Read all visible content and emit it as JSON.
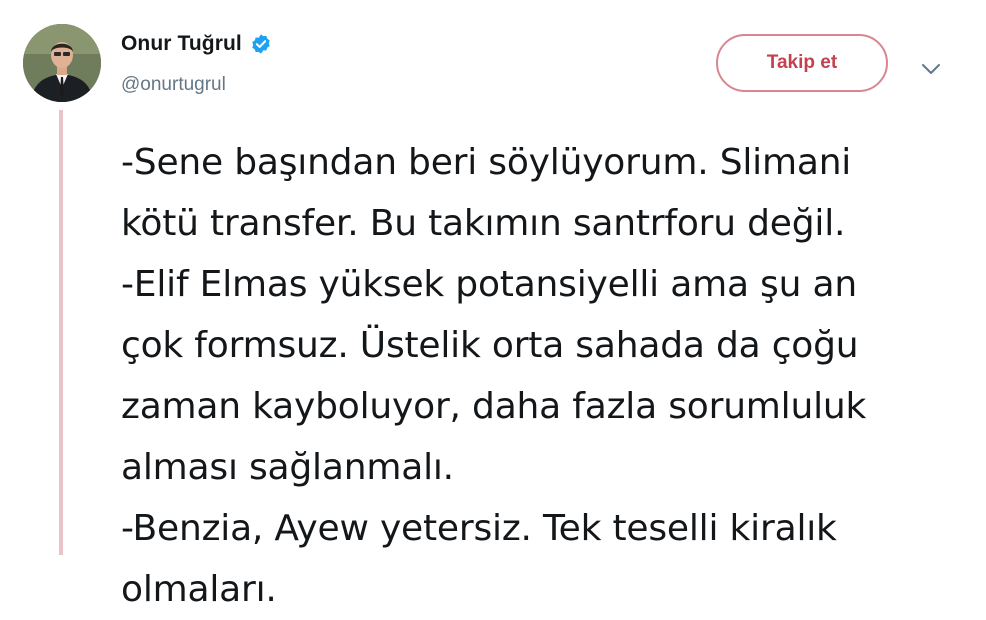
{
  "tweet": {
    "author": {
      "display_name": "Onur Tuğrul",
      "handle": "@onurtugrul",
      "verified": true,
      "avatar_icon": "profile-photo"
    },
    "follow_label": "Takip et",
    "menu_icon": "chevron-down-icon",
    "text": "-Sene başından beri söylüyorum. Slimani\nkötü transfer. Bu takımın santrforu değil.\n-Elif Elmas yüksek potansiyelli ama şu an\nçok formsuz. Üstelik orta sahada da çoğu\nzaman kayboluyor, daha fazla sorumluluk\nalması sağlanmalı.\n-Benzia, Ayew yetersiz. Tek teselli kiralık\nolmaları."
  },
  "colors": {
    "accent": "#c4414f",
    "verified": "#1da1f2",
    "thread_line": "#e9c3c8",
    "handle": "#657786"
  }
}
